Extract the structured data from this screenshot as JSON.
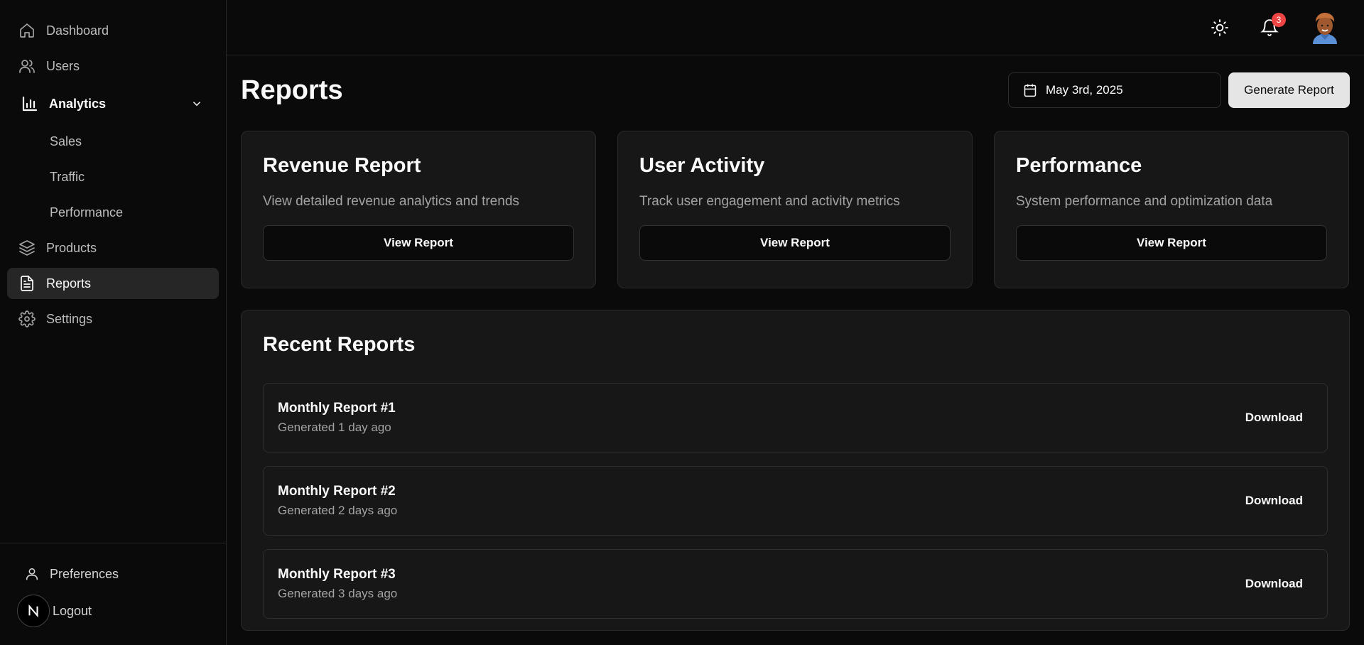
{
  "sidebar": {
    "items": [
      {
        "label": "Dashboard",
        "icon": "home-icon"
      },
      {
        "label": "Users",
        "icon": "users-icon"
      },
      {
        "label": "Analytics",
        "icon": "bar-chart-icon",
        "expanded": true,
        "children": [
          {
            "label": "Sales"
          },
          {
            "label": "Traffic"
          },
          {
            "label": "Performance"
          }
        ]
      },
      {
        "label": "Products",
        "icon": "layers-icon"
      },
      {
        "label": "Reports",
        "icon": "file-text-icon",
        "active": true
      },
      {
        "label": "Settings",
        "icon": "gear-icon"
      }
    ],
    "footer": {
      "preferences": "Preferences",
      "logout": "Logout"
    }
  },
  "topbar": {
    "notification_count": "3",
    "icons": [
      "sun-icon",
      "bell-icon",
      "avatar"
    ]
  },
  "page": {
    "title": "Reports",
    "date": "May 3rd, 2025",
    "generate_label": "Generate Report"
  },
  "cards": [
    {
      "title": "Revenue Report",
      "description": "View detailed revenue analytics and trends",
      "button": "View Report"
    },
    {
      "title": "User Activity",
      "description": "Track user engagement and activity metrics",
      "button": "View Report"
    },
    {
      "title": "Performance",
      "description": "System performance and optimization data",
      "button": "View Report"
    }
  ],
  "recent": {
    "title": "Recent Reports",
    "rows": [
      {
        "name": "Monthly Report #1",
        "time": "Generated 1 day ago",
        "action": "Download"
      },
      {
        "name": "Monthly Report #2",
        "time": "Generated 2 days ago",
        "action": "Download"
      },
      {
        "name": "Monthly Report #3",
        "time": "Generated 3 days ago",
        "action": "Download"
      }
    ]
  },
  "colors": {
    "background": "#0a0a0a",
    "card": "#171717",
    "border": "#2a2a2a",
    "badge": "#ef4444",
    "primary_button": "#e5e5e5"
  }
}
